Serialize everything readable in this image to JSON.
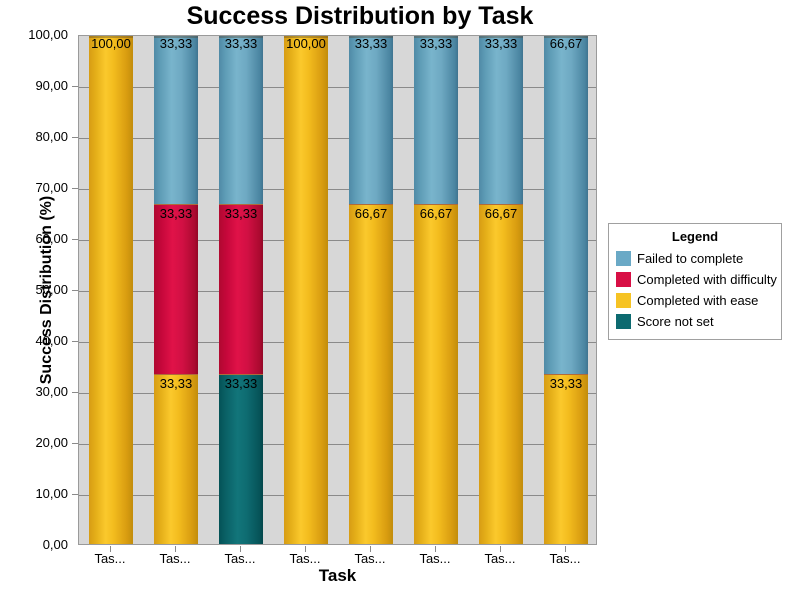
{
  "chart_data": {
    "type": "bar",
    "subtype": "stacked-percentage-column",
    "title": "Success Distribution by Task",
    "xlabel": "Task",
    "ylabel": "Success Distribution (%)",
    "ylim": [
      0,
      100
    ],
    "ytick_labels": [
      "100,00",
      "90,00",
      "80,00",
      "70,00",
      "60,00",
      "50,00",
      "40,00",
      "30,00",
      "20,00",
      "10,00",
      "0,00"
    ],
    "ytick_values": [
      100,
      90,
      80,
      70,
      60,
      50,
      40,
      30,
      20,
      10,
      0
    ],
    "grid": true,
    "grid_axis": "y",
    "legend_position": "right",
    "legend_title": "Legend",
    "decimal_separator": ",",
    "categories": [
      "Tas...",
      "Tas...",
      "Tas...",
      "Tas...",
      "Tas...",
      "Tas...",
      "Tas...",
      "Tas..."
    ],
    "series": [
      {
        "name": "Failed to complete",
        "color": "#6aa9c6",
        "values": [
          0,
          33.33,
          33.33,
          0,
          33.33,
          33.33,
          33.33,
          66.67
        ],
        "labels": [
          "",
          "33,33",
          "33,33",
          "",
          "33,33",
          "33,33",
          "33,33",
          "66,67"
        ]
      },
      {
        "name": "Completed with difficulty",
        "color": "#d80f45",
        "values": [
          0,
          33.33,
          33.33,
          0,
          0,
          0,
          0,
          0
        ],
        "labels": [
          "",
          "33,33",
          "33,33",
          "",
          "",
          "",
          "",
          ""
        ]
      },
      {
        "name": "Completed with ease",
        "color": "#f6c324",
        "values": [
          100.0,
          33.33,
          0,
          100.0,
          66.67,
          66.67,
          66.67,
          33.33
        ],
        "labels": [
          "100,00",
          "33,33",
          "",
          "100,00",
          "66,67",
          "66,67",
          "66,67",
          "33,33"
        ]
      },
      {
        "name": "Score not set",
        "color": "#0c6a70",
        "values": [
          0,
          0,
          33.33,
          0,
          0,
          0,
          0,
          0
        ],
        "labels": [
          "",
          "",
          "33,33",
          "",
          "",
          "",
          "",
          ""
        ]
      }
    ],
    "bars": [
      {
        "category": "Tas...",
        "segments": [
          {
            "series": "Completed with ease",
            "value": 100.0,
            "label": "100,00",
            "style": "seg-gold"
          }
        ]
      },
      {
        "category": "Tas...",
        "segments": [
          {
            "series": "Completed with ease",
            "value": 33.33,
            "label": "33,33",
            "style": "seg-gold"
          },
          {
            "series": "Completed with difficulty",
            "value": 33.33,
            "label": "33,33",
            "style": "seg-red"
          },
          {
            "series": "Failed to complete",
            "value": 33.33,
            "label": "33,33",
            "style": "seg-blue"
          }
        ]
      },
      {
        "category": "Tas...",
        "segments": [
          {
            "series": "Score not set",
            "value": 33.33,
            "label": "33,33",
            "style": "seg-teal"
          },
          {
            "series": "Completed with difficulty",
            "value": 33.33,
            "label": "33,33",
            "style": "seg-red"
          },
          {
            "series": "Failed to complete",
            "value": 33.33,
            "label": "33,33",
            "style": "seg-blue"
          }
        ]
      },
      {
        "category": "Tas...",
        "segments": [
          {
            "series": "Completed with ease",
            "value": 100.0,
            "label": "100,00",
            "style": "seg-gold"
          }
        ]
      },
      {
        "category": "Tas...",
        "segments": [
          {
            "series": "Completed with ease",
            "value": 66.67,
            "label": "66,67",
            "style": "seg-gold"
          },
          {
            "series": "Failed to complete",
            "value": 33.33,
            "label": "33,33",
            "style": "seg-blue"
          }
        ]
      },
      {
        "category": "Tas...",
        "segments": [
          {
            "series": "Completed with ease",
            "value": 66.67,
            "label": "66,67",
            "style": "seg-gold"
          },
          {
            "series": "Failed to complete",
            "value": 33.33,
            "label": "33,33",
            "style": "seg-blue"
          }
        ]
      },
      {
        "category": "Tas...",
        "segments": [
          {
            "series": "Completed with ease",
            "value": 66.67,
            "label": "66,67",
            "style": "seg-gold"
          },
          {
            "series": "Failed to complete",
            "value": 33.33,
            "label": "33,33",
            "style": "seg-blue"
          }
        ]
      },
      {
        "category": "Tas...",
        "segments": [
          {
            "series": "Completed with ease",
            "value": 33.33,
            "label": "33,33",
            "style": "seg-gold"
          },
          {
            "series": "Failed to complete",
            "value": 66.67,
            "label": "66,67",
            "style": "seg-blue"
          }
        ]
      }
    ]
  },
  "legend": {
    "title": "Legend",
    "items": [
      {
        "label": "Failed to complete",
        "color": "#6aa9c6"
      },
      {
        "label": "Completed with difficulty",
        "color": "#d80f45"
      },
      {
        "label": "Completed with ease",
        "color": "#f6c324"
      },
      {
        "label": "Score not set",
        "color": "#0c6a70"
      }
    ]
  }
}
